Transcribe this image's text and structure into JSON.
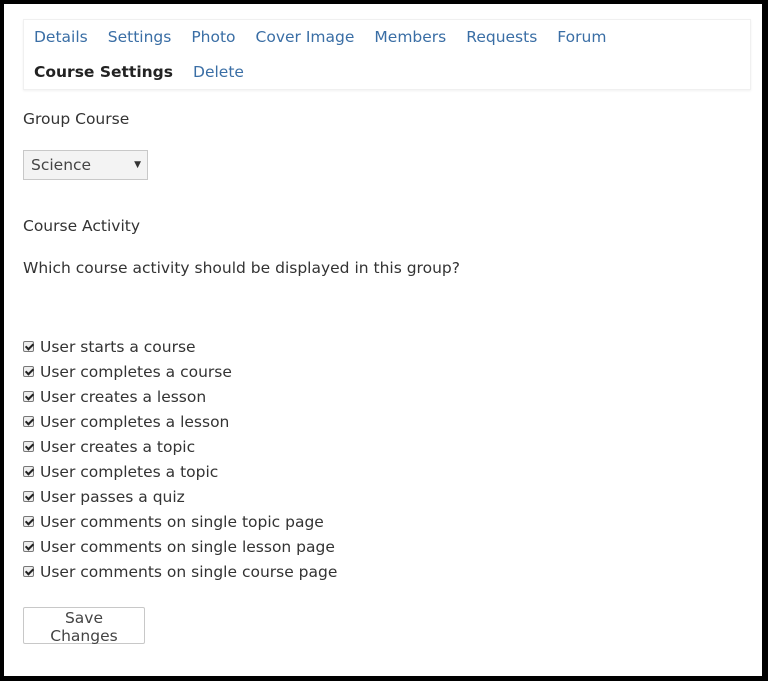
{
  "tabs": [
    {
      "label": "Details"
    },
    {
      "label": "Settings"
    },
    {
      "label": "Photo"
    },
    {
      "label": "Cover Image"
    },
    {
      "label": "Members"
    },
    {
      "label": "Requests"
    },
    {
      "label": "Forum"
    },
    {
      "label": "Course Settings",
      "active": true
    },
    {
      "label": "Delete"
    }
  ],
  "group_course": {
    "label": "Group Course",
    "selected": "Science"
  },
  "course_activity": {
    "label": "Course Activity",
    "question": "Which course activity should be displayed in this group?",
    "options": [
      {
        "label": "User starts a course",
        "checked": true
      },
      {
        "label": "User completes a course",
        "checked": true
      },
      {
        "label": "User creates a lesson",
        "checked": true
      },
      {
        "label": "User completes a lesson",
        "checked": true
      },
      {
        "label": "User creates a topic",
        "checked": true
      },
      {
        "label": "User completes a topic",
        "checked": true
      },
      {
        "label": "User passes a quiz",
        "checked": true
      },
      {
        "label": "User comments on single topic page",
        "checked": true
      },
      {
        "label": "User comments on single lesson page",
        "checked": true
      },
      {
        "label": "User comments on single course page",
        "checked": true
      }
    ]
  },
  "save_label": "Save Changes",
  "colors": {
    "link": "#3a6ea5",
    "active_tab": "#222222",
    "text": "#333333"
  }
}
